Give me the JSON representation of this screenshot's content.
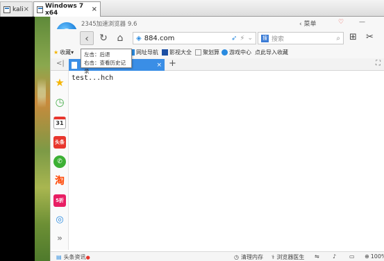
{
  "vm_tabs": [
    {
      "label": "kali",
      "close": "×"
    },
    {
      "label": "Windows 7 x64",
      "close": "×"
    }
  ],
  "browser": {
    "app_title": "2345加速浏览器 9.6",
    "logo_letter": "e",
    "window_controls": {
      "menu": "菜单",
      "skin": "♡",
      "minimize": "—"
    },
    "address": "884.com",
    "search_placeholder": "搜索",
    "tooltip": {
      "line1": "左击：后退",
      "line2": "右击：查看历史记录"
    },
    "bookmarks": [
      {
        "label": "收藏",
        "icon": "star-icon"
      },
      {
        "label": "网址导航",
        "icon": "grid-icon"
      },
      {
        "label": "影视大全",
        "icon": "video-icon"
      },
      {
        "label": "聚划算",
        "icon": "page-icon"
      },
      {
        "label": "游戏中心",
        "icon": "game-icon"
      },
      {
        "label": "点此导入收藏",
        "icon": "import-link"
      }
    ],
    "tab_nav": "<|",
    "new_tab": "+",
    "page_content": "test...hch",
    "sidebar": [
      {
        "name": "favorites-icon",
        "glyph": "★",
        "color": "#f5b400"
      },
      {
        "name": "history-icon",
        "glyph": "◷",
        "color": "#4caf50"
      },
      {
        "name": "calendar-icon",
        "glyph": "31",
        "color": "#ffffff"
      },
      {
        "name": "toutiao-icon",
        "glyph": "头条",
        "color": "#e8362d"
      },
      {
        "name": "wechat-icon",
        "glyph": "✆",
        "color": "#3cb034"
      },
      {
        "name": "taobao-icon",
        "glyph": "淘",
        "color": "#ff4400"
      },
      {
        "name": "sale-icon",
        "glyph": "5折",
        "color": "#e81e63"
      },
      {
        "name": "gamepad-icon",
        "glyph": "◎",
        "color": "#2a8be0"
      },
      {
        "name": "more-icon",
        "glyph": "»",
        "color": "#888888"
      }
    ],
    "status": {
      "news": "头条资讯",
      "clean_memory": "清理内存",
      "browser_doctor": "浏览器医生",
      "zoom": "100%"
    }
  },
  "colors": {
    "accent": "#3a8ee6",
    "logo": "#1479d8"
  }
}
